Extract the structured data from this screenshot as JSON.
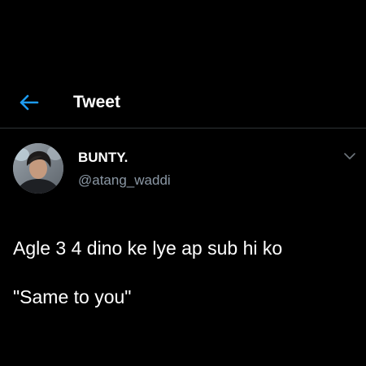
{
  "header": {
    "back_icon": "arrow-left-icon",
    "title": "Tweet"
  },
  "tweet": {
    "display_name": "BUNTY.",
    "handle": "@atang_waddi",
    "text_line_1": "Agle 3 4 dino ke lye ap sub hi ko",
    "text_line_2": "\"Same to you\"",
    "more_icon": "chevron-down-icon"
  },
  "colors": {
    "background": "#000000",
    "accent": "#1d9bf0",
    "secondary_text": "#8b98a5",
    "divider": "#2f3336"
  }
}
